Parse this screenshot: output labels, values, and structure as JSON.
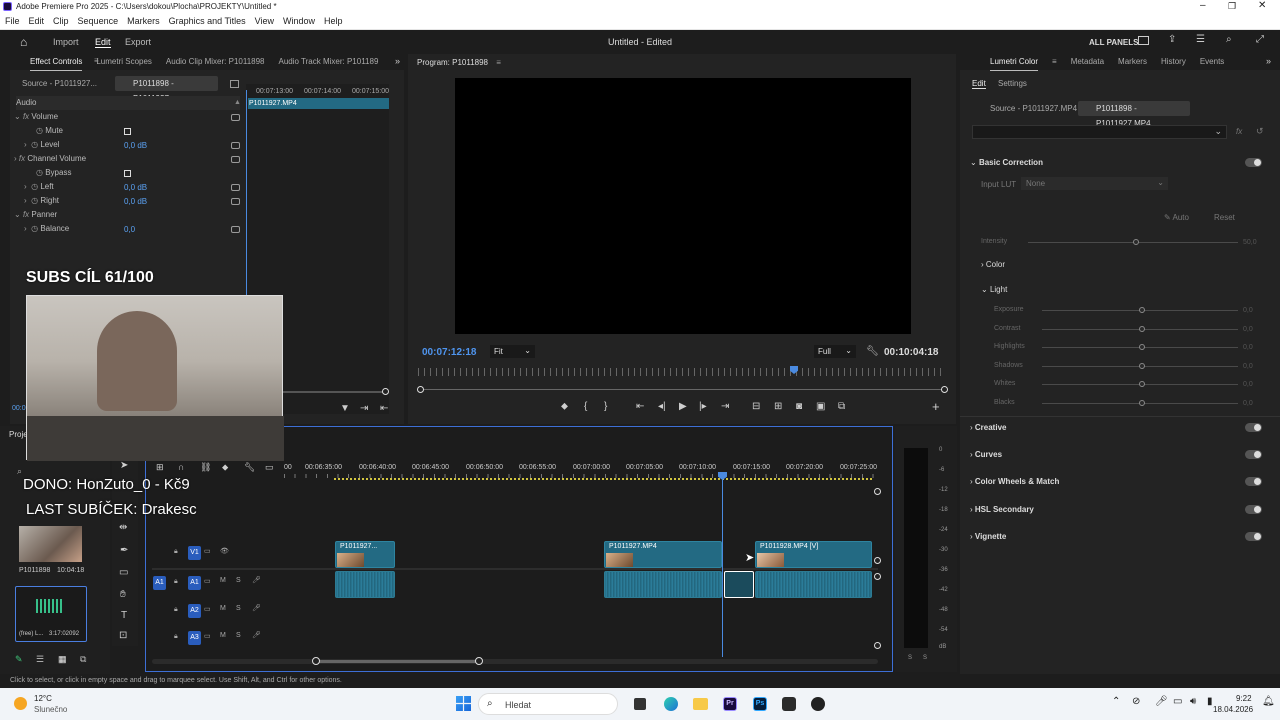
{
  "titlebar": {
    "title": "Adobe Premiere Pro 2025 - C:\\Users\\dokou\\Plocha\\PROJEKTY\\Untitled *"
  },
  "menu": [
    "File",
    "Edit",
    "Clip",
    "Sequence",
    "Markers",
    "Graphics and Titles",
    "View",
    "Window",
    "Help"
  ],
  "header": {
    "import": "Import",
    "edit": "Edit",
    "export": "Export",
    "doc_title": "Untitled",
    "doc_state": "- Edited",
    "all_panels": "ALL PANELS"
  },
  "left_tabs": [
    "Effect Controls",
    "Lumetri Scopes",
    "Audio Clip Mixer: P1011898",
    "Audio Track Mixer: P101189"
  ],
  "ec": {
    "source_tab": "Source - P1011927...",
    "seq_tab": "P1011898 - P1011927...",
    "ruler": [
      "00:07:13:00",
      "00:07:14:00",
      "00:07:15:00"
    ],
    "clip_name": "P1011927.MP4",
    "audio_label": "Audio",
    "rows": [
      {
        "name": "Volume",
        "value": ""
      },
      {
        "name": "Mute",
        "value": ""
      },
      {
        "name": "Level",
        "value": "0,0 dB"
      },
      {
        "name": "Channel Volume",
        "value": ""
      },
      {
        "name": "Bypass",
        "value": ""
      },
      {
        "name": "Left",
        "value": "0,0 dB"
      },
      {
        "name": "Right",
        "value": "0,0 dB"
      },
      {
        "name": "Panner",
        "value": ""
      },
      {
        "name": "Balance",
        "value": "0,0"
      }
    ],
    "timecode": "00:0"
  },
  "overlay": {
    "subs": "SUBS CÍL 61/100",
    "dono": "DONO: HonZuto_0 - Kč9",
    "last_sub": "LAST SUBÍČEK: Drakesc"
  },
  "project": {
    "tab": "Proje",
    "items": [
      {
        "name": "P1011898",
        "duration": "10:04:18"
      },
      {
        "name": "(free) L...",
        "duration": "3:17:02092"
      }
    ]
  },
  "program": {
    "title": "Program: P1011898",
    "timecode_left": "00:07:12:18",
    "fit": "Fit",
    "full": "Full",
    "timecode_right": "00:10:04:18"
  },
  "timeline": {
    "ruler": [
      "00",
      "00:06:35:00",
      "00:06:40:00",
      "00:06:45:00",
      "00:06:50:00",
      "00:06:55:00",
      "00:07:00:00",
      "00:07:05:00",
      "00:07:10:00",
      "00:07:15:00",
      "00:07:20:00",
      "00:07:25:00"
    ],
    "tracks_video": [
      "V1"
    ],
    "tracks_audio": [
      "A1",
      "A2",
      "A3"
    ],
    "clips": [
      {
        "label": "P1011927..."
      },
      {
        "label": "P1011927.MP4"
      },
      {
        "label": "P1011928.MP4 [V]"
      }
    ],
    "meter_labels": [
      "0",
      "-6",
      "-12",
      "-18",
      "-24",
      "-30",
      "-36",
      "-42",
      "-48",
      "-54",
      "dB"
    ],
    "meter_bottom": [
      "S",
      "S"
    ]
  },
  "lumetri": {
    "tabs": [
      "Lumetri Color",
      "Metadata",
      "Markers",
      "History",
      "Events"
    ],
    "subtabs": [
      "Edit",
      "Settings"
    ],
    "source_tab": "Source - P1011927.MP4",
    "seq_tab": "P1011898 - P1011927.MP4",
    "basic": "Basic Correction",
    "input_lut_label": "Input LUT",
    "input_lut_value": "None",
    "auto": "Auto",
    "reset": "Reset",
    "intensity": "Intensity",
    "intensity_val": "50,0",
    "color": "Color",
    "light": "Light",
    "light_rows": [
      "Exposure",
      "Contrast",
      "Highlights",
      "Shadows",
      "Whites",
      "Blacks"
    ],
    "light_val": "0,0",
    "sections": [
      "Creative",
      "Curves",
      "Color Wheels & Match",
      "HSL Secondary",
      "Vignette"
    ]
  },
  "status": "Click to select, or click in empty space and drag to marquee select. Use Shift, Alt, and Ctrl for other options.",
  "taskbar": {
    "temp": "12°C",
    "weather": "Slunečno",
    "search": "Hledat",
    "time": "9:22",
    "date": "18.04.2026"
  }
}
